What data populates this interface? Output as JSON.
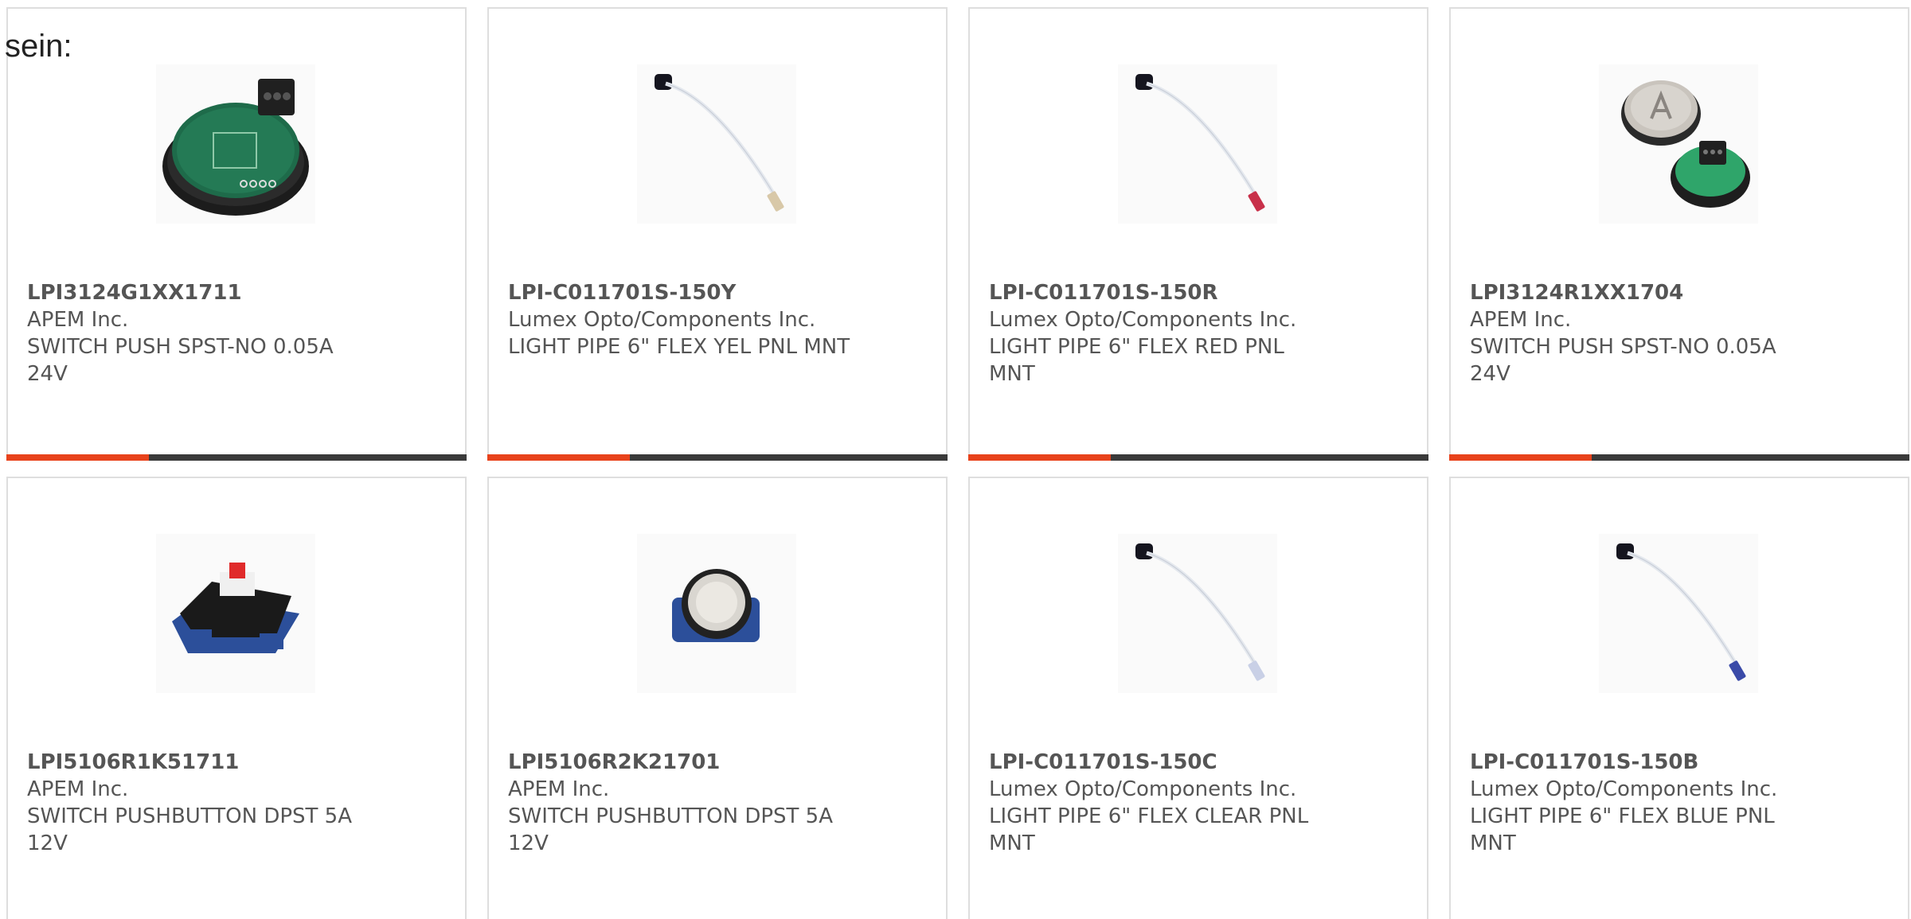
{
  "intro_text": "sein:",
  "products": [
    {
      "part_number": "LPI3124G1XX1711",
      "manufacturer": "APEM Inc.",
      "description": "SWITCH PUSH SPST-NO 0.05A 24V",
      "image_icon": "green-pcb-push-switch-icon",
      "progress": 0.31
    },
    {
      "part_number": "LPI-C011701S-150Y",
      "manufacturer": "Lumex Opto/Components Inc.",
      "description": "LIGHT PIPE 6\" FLEX YEL PNL MNT",
      "image_icon": "flex-light-pipe-icon",
      "tip_color": "#d8c8a8",
      "progress": 0.31
    },
    {
      "part_number": "LPI-C011701S-150R",
      "manufacturer": "Lumex Opto/Components Inc.",
      "description": "LIGHT PIPE 6\" FLEX RED PNL MNT",
      "image_icon": "flex-light-pipe-icon",
      "tip_color": "#c8304a",
      "progress": 0.31
    },
    {
      "part_number": "LPI3124R1XX1704",
      "manufacturer": "APEM Inc.",
      "description": "SWITCH PUSH SPST-NO 0.05A 24V",
      "image_icon": "elevator-push-button-icon",
      "progress": 0.31
    },
    {
      "part_number": "LPI5106R1K51711",
      "manufacturer": "APEM Inc.",
      "description": "SWITCH PUSHBUTTON DPST 5A 12V",
      "image_icon": "blue-base-switch-icon",
      "progress": null
    },
    {
      "part_number": "LPI5106R2K21701",
      "manufacturer": "APEM Inc.",
      "description": "SWITCH PUSHBUTTON DPST 5A 12V",
      "image_icon": "round-push-button-icon",
      "progress": null
    },
    {
      "part_number": "LPI-C011701S-150C",
      "manufacturer": "Lumex Opto/Components Inc.",
      "description": "LIGHT PIPE 6\" FLEX CLEAR PNL MNT",
      "image_icon": "flex-light-pipe-icon",
      "tip_color": "#c9d0e6",
      "progress": null
    },
    {
      "part_number": "LPI-C011701S-150B",
      "manufacturer": "Lumex Opto/Components Inc.",
      "description": "LIGHT PIPE 6\" FLEX BLUE PNL MNT",
      "image_icon": "flex-light-pipe-icon",
      "tip_color": "#3a4aa8",
      "progress": null
    }
  ],
  "colors": {
    "accent": "#e8421b",
    "bar_track": "#3a3a3a",
    "card_border": "#dedede",
    "text": "#555555"
  }
}
